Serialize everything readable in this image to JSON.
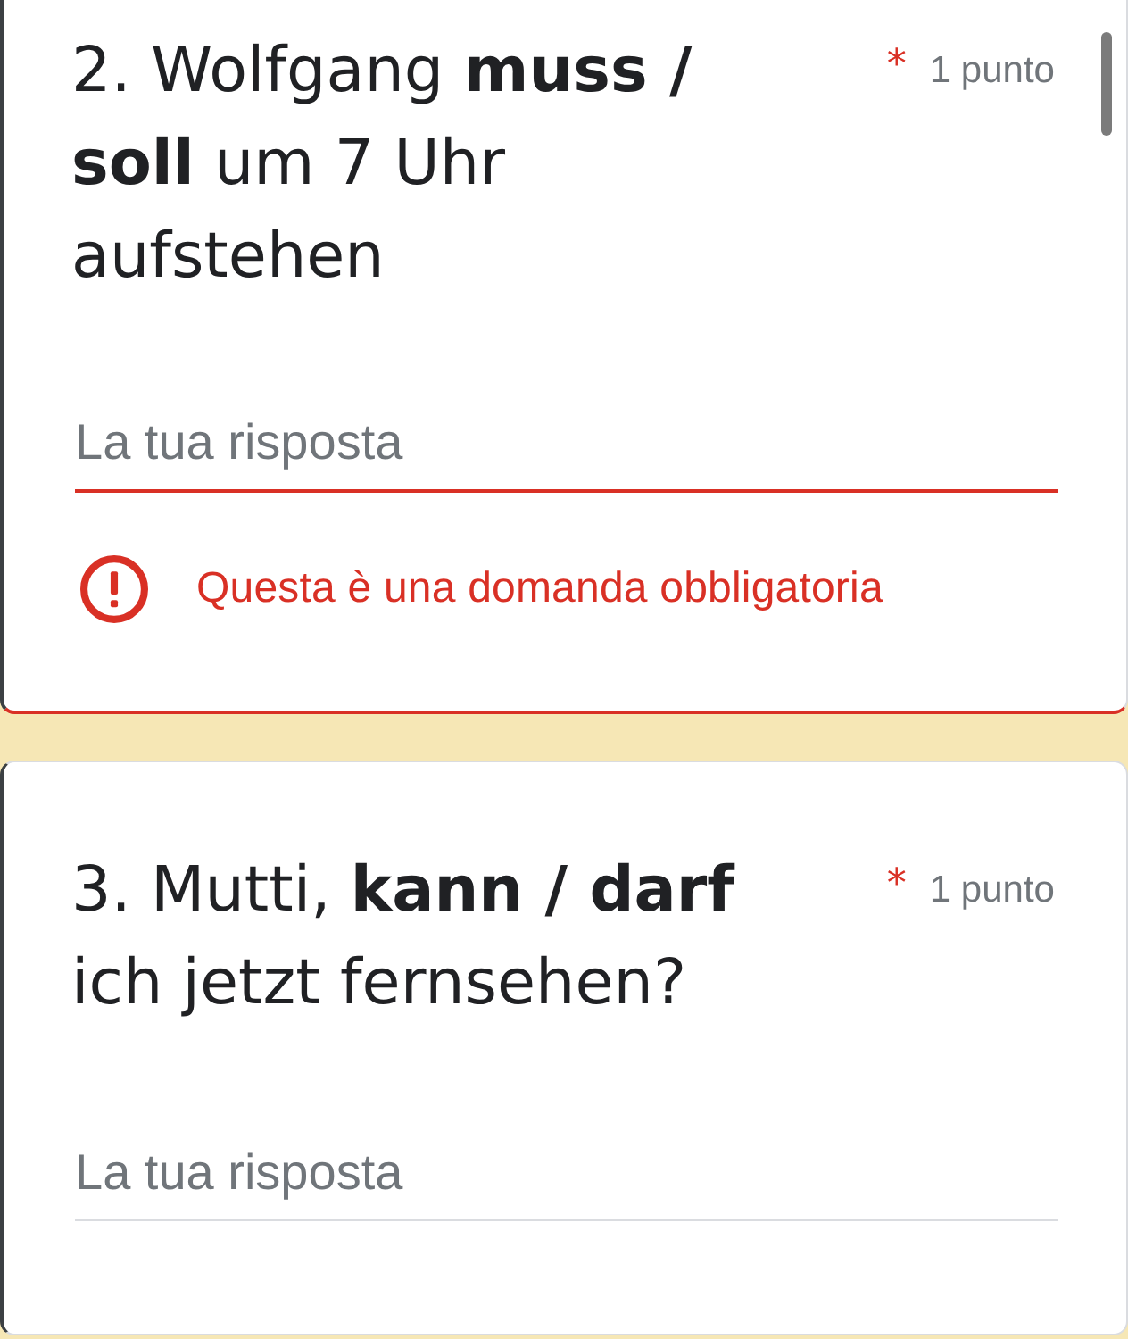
{
  "questions": [
    {
      "title": "2. Wolfgang **muss / soll** um 7 Uhr aufstehen",
      "required_mark": "*",
      "points": "1 punto",
      "answer": {
        "placeholder": "La tua risposta",
        "invalid": true
      },
      "error": "Questa è una domanda obbligatoria"
    },
    {
      "title": "3. Mutti, **kann / darf** ich jetzt fernsehen?",
      "required_mark": "*",
      "points": "1 punto",
      "answer": {
        "placeholder": "La tua risposta",
        "invalid": false
      }
    }
  ]
}
